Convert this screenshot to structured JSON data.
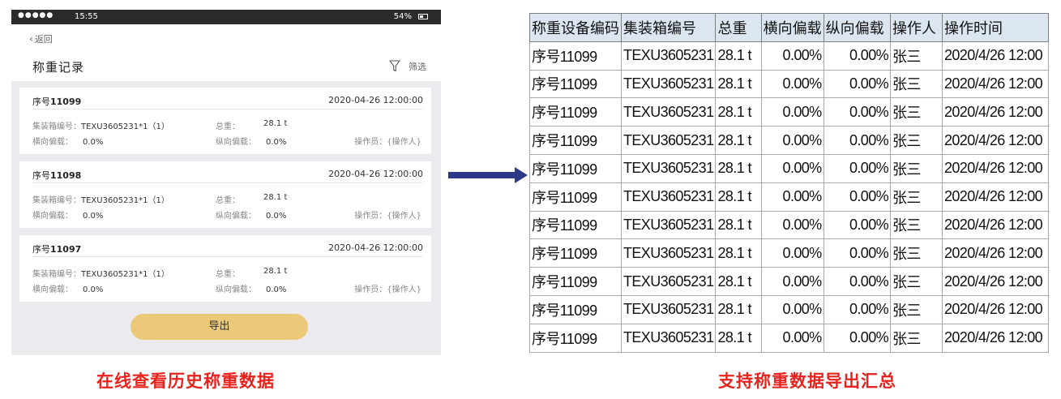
{
  "status_bar": {
    "signal": "●●●●●",
    "time": "15:55",
    "battery": "54%"
  },
  "nav": {
    "back_label": "返回",
    "title": "称重记录",
    "filter_label": "筛选"
  },
  "records": [
    {
      "seq_prefix": "序号",
      "seq_no": "11099",
      "date": "2020-04-26 12:00:00",
      "container_label": "集装箱编号：",
      "container_value": "TEXU3605231*1（1）",
      "weight_label": "总重：",
      "weight_value": "28.1 t",
      "h_label": "横向偏载：",
      "h_value": "0.0%",
      "v_label": "纵向偏载：",
      "v_value": "0.0%",
      "operator": "操作员：{操作人}"
    },
    {
      "seq_prefix": "序号",
      "seq_no": "11098",
      "date": "2020-04-26 12:00:00",
      "container_label": "集装箱编号：",
      "container_value": "TEXU3605231*1（1）",
      "weight_label": "总重：",
      "weight_value": "28.1 t",
      "h_label": "横向偏载：",
      "h_value": "0.0%",
      "v_label": "纵向偏载：",
      "v_value": "0.0%",
      "operator": "操作员：{操作人}"
    },
    {
      "seq_prefix": "序号",
      "seq_no": "11097",
      "date": "2020-04-26 12:00:00",
      "container_label": "集装箱编号：",
      "container_value": "TEXU3605231*1（1）",
      "weight_label": "总重：",
      "weight_value": "28.1 t",
      "h_label": "横向偏载：",
      "h_value": "0.0%",
      "v_label": "纵向偏载：",
      "v_value": "0.0%",
      "operator": "操作员：{操作人}"
    }
  ],
  "export_label": "导出",
  "sheet": {
    "headers": [
      "称重设备编码",
      "集装箱编号",
      "总重",
      "横向偏载",
      "纵向偏载",
      "操作人",
      "操作时间"
    ],
    "rows": [
      [
        "序号11099",
        "TEXU3605231",
        "28.1 t",
        "0.00%",
        "0.00%",
        "张三",
        "2020/4/26 12:00"
      ],
      [
        "序号11099",
        "TEXU3605231",
        "28.1 t",
        "0.00%",
        "0.00%",
        "张三",
        "2020/4/26 12:00"
      ],
      [
        "序号11099",
        "TEXU3605231",
        "28.1 t",
        "0.00%",
        "0.00%",
        "张三",
        "2020/4/26 12:00"
      ],
      [
        "序号11099",
        "TEXU3605231",
        "28.1 t",
        "0.00%",
        "0.00%",
        "张三",
        "2020/4/26 12:00"
      ],
      [
        "序号11099",
        "TEXU3605231",
        "28.1 t",
        "0.00%",
        "0.00%",
        "张三",
        "2020/4/26 12:00"
      ],
      [
        "序号11099",
        "TEXU3605231",
        "28.1 t",
        "0.00%",
        "0.00%",
        "张三",
        "2020/4/26 12:00"
      ],
      [
        "序号11099",
        "TEXU3605231",
        "28.1 t",
        "0.00%",
        "0.00%",
        "张三",
        "2020/4/26 12:00"
      ],
      [
        "序号11099",
        "TEXU3605231",
        "28.1 t",
        "0.00%",
        "0.00%",
        "张三",
        "2020/4/26 12:00"
      ],
      [
        "序号11099",
        "TEXU3605231",
        "28.1 t",
        "0.00%",
        "0.00%",
        "张三",
        "2020/4/26 12:00"
      ],
      [
        "序号11099",
        "TEXU3605231",
        "28.1 t",
        "0.00%",
        "0.00%",
        "张三",
        "2020/4/26 12:00"
      ],
      [
        "序号11099",
        "TEXU3605231",
        "28.1 t",
        "0.00%",
        "0.00%",
        "张三",
        "2020/4/26 12:00"
      ]
    ]
  },
  "captions": {
    "left": "在线查看历史称重数据",
    "right": "支持称重数据导出汇总"
  },
  "colors": {
    "accent_button": "#ecc978",
    "caption_red": "#e8231d",
    "arrow_navy": "#2a3a86",
    "header_fill": "#dce6f1"
  }
}
